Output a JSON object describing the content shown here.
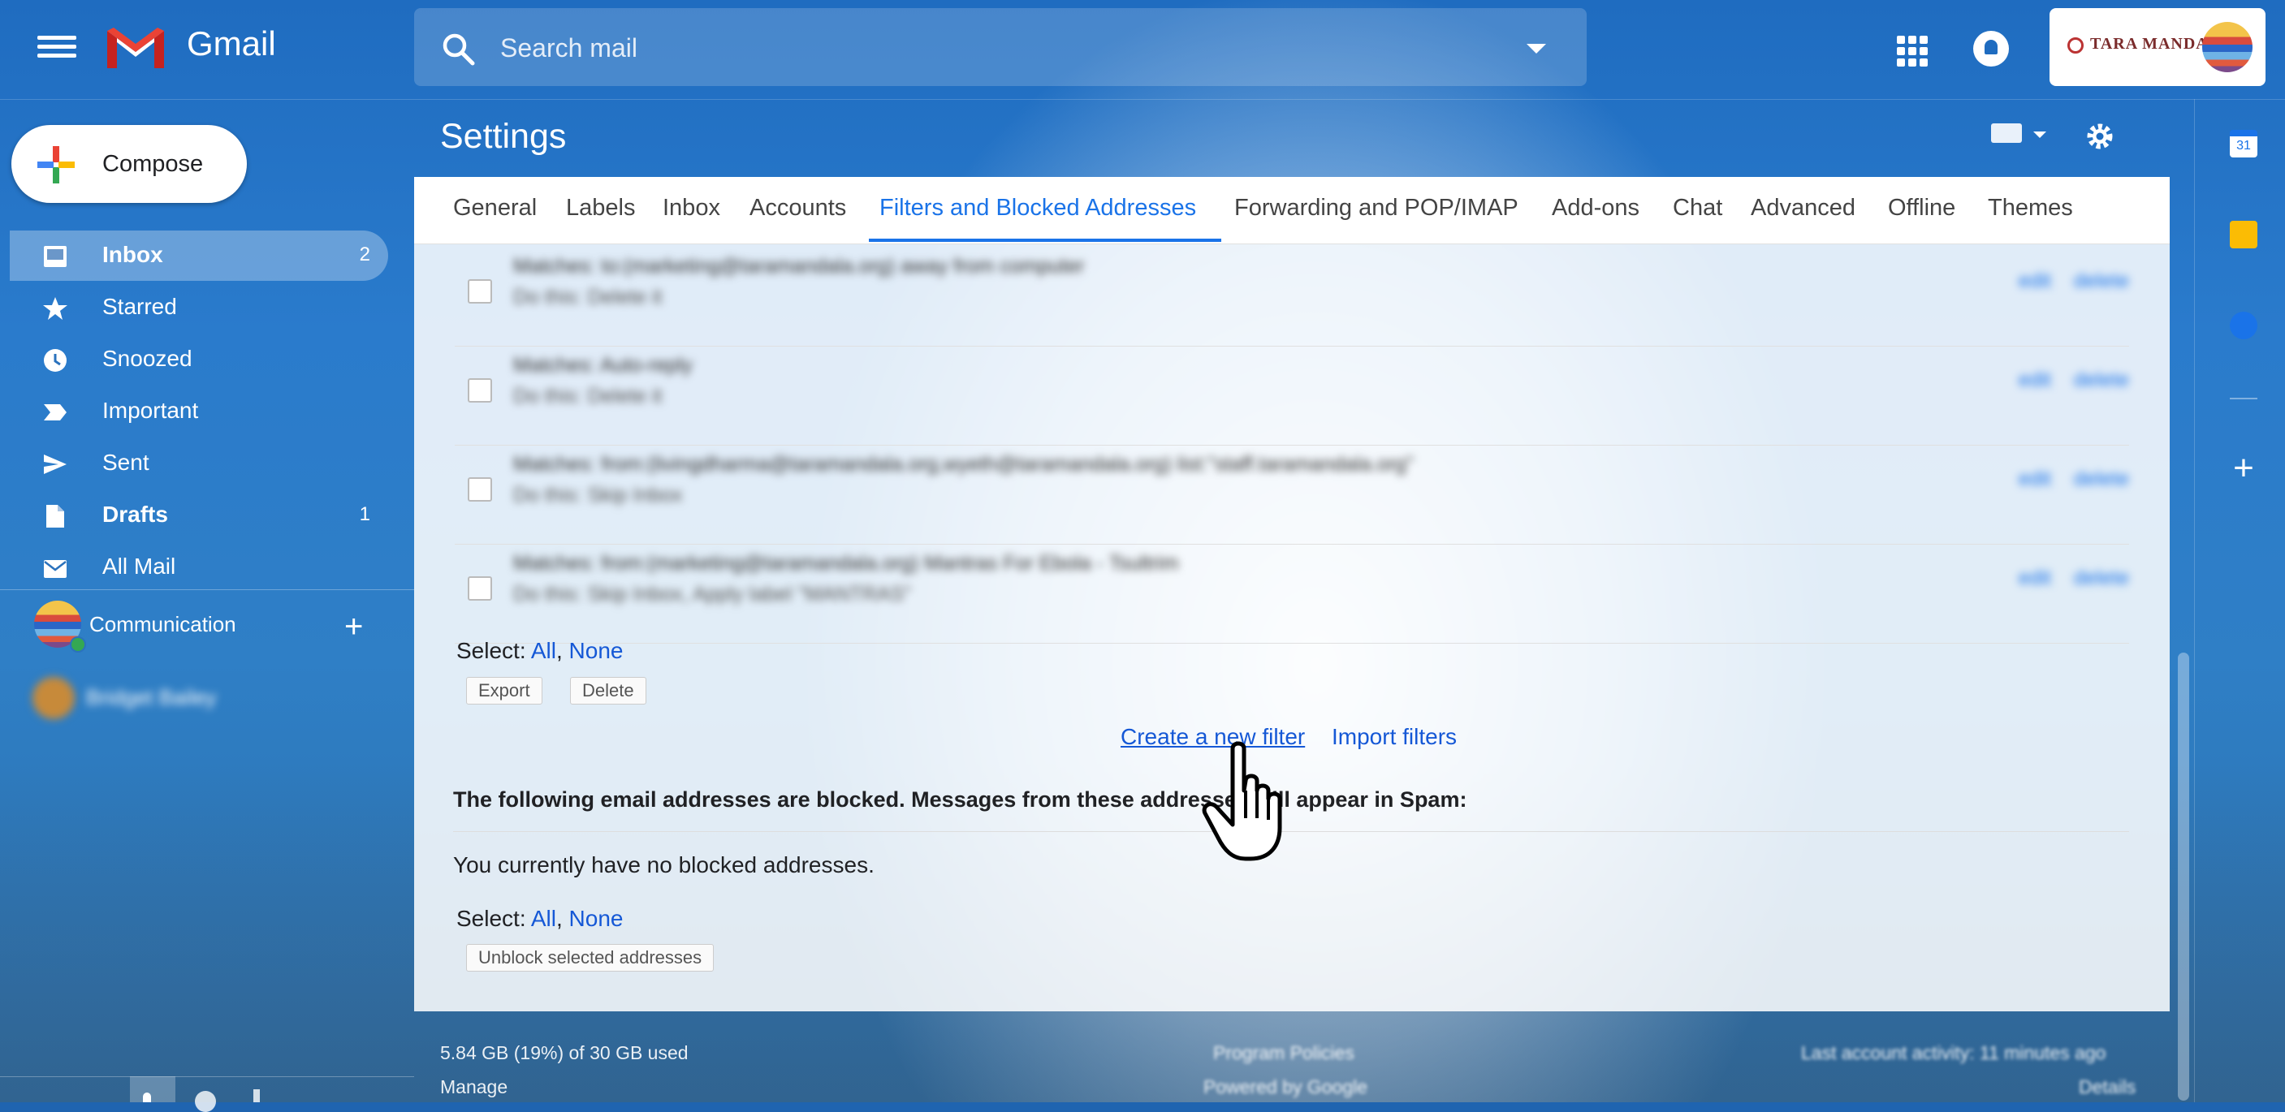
{
  "header": {
    "app_name": "Gmail",
    "search_placeholder": "Search mail",
    "brand_text": "TARA MANDALA"
  },
  "compose_label": "Compose",
  "nav": [
    {
      "label": "Inbox",
      "count": "2",
      "bold": true,
      "active": true,
      "icon": "inbox-icon"
    },
    {
      "label": "Starred",
      "count": "",
      "icon": "star-icon"
    },
    {
      "label": "Snoozed",
      "count": "",
      "icon": "clock-icon"
    },
    {
      "label": "Important",
      "count": "",
      "icon": "important-icon"
    },
    {
      "label": "Sent",
      "count": "",
      "icon": "send-icon"
    },
    {
      "label": "Drafts",
      "count": "1",
      "bold": true,
      "icon": "draft-icon"
    },
    {
      "label": "All Mail",
      "count": "",
      "icon": "mail-icon"
    }
  ],
  "communication_label": "Communication",
  "hangouts_contact": "Bridget Bailey",
  "settings_title": "Settings",
  "tabs": [
    "General",
    "Labels",
    "Inbox",
    "Accounts",
    "Filters and Blocked Addresses",
    "Forwarding and POP/IMAP",
    "Add-ons",
    "Chat",
    "Advanced",
    "Offline",
    "Themes"
  ],
  "filters": [
    {
      "matches": "Matches: to:(marketing@taramandala.org) away from computer",
      "action": "Do this: Delete it"
    },
    {
      "matches": "Matches: Auto-reply",
      "action": "Do this: Delete it"
    },
    {
      "matches": "Matches: from:(livingdharma@taramandala.org,wyeth@taramandala.org) list:\"staff.taramandala.org\"",
      "action": "Do this: Skip Inbox"
    },
    {
      "matches": "Matches: from:(marketing@taramandala.org) Mantras For Ebola - Tsultrim",
      "action": "Do this: Skip Inbox, Apply label \"MANTRAS\""
    }
  ],
  "filter_edit": "edit",
  "filter_delete": "delete",
  "select_label": "Select:",
  "select_all": "All",
  "select_none": "None",
  "comma": ",",
  "export_label": "Export",
  "delete_label": "Delete",
  "create_filter": "Create a new filter",
  "import_filters": "Import filters",
  "blocked_heading": "The following email addresses are blocked. Messages from these addresses will appear in Spam:",
  "no_blocked": "You currently have no blocked addresses.",
  "unblock_label": "Unblock selected addresses",
  "footer": {
    "storage": "5.84 GB (19%) of 30 GB used",
    "manage": "Manage",
    "program_policies": "Program Policies",
    "powered": "Powered by Google",
    "last_activity": "Last account activity: 11 minutes ago",
    "details": "Details"
  },
  "colors": {
    "accent": "#1a73e8",
    "link": "#1558d6",
    "background": "#1f64b0"
  }
}
